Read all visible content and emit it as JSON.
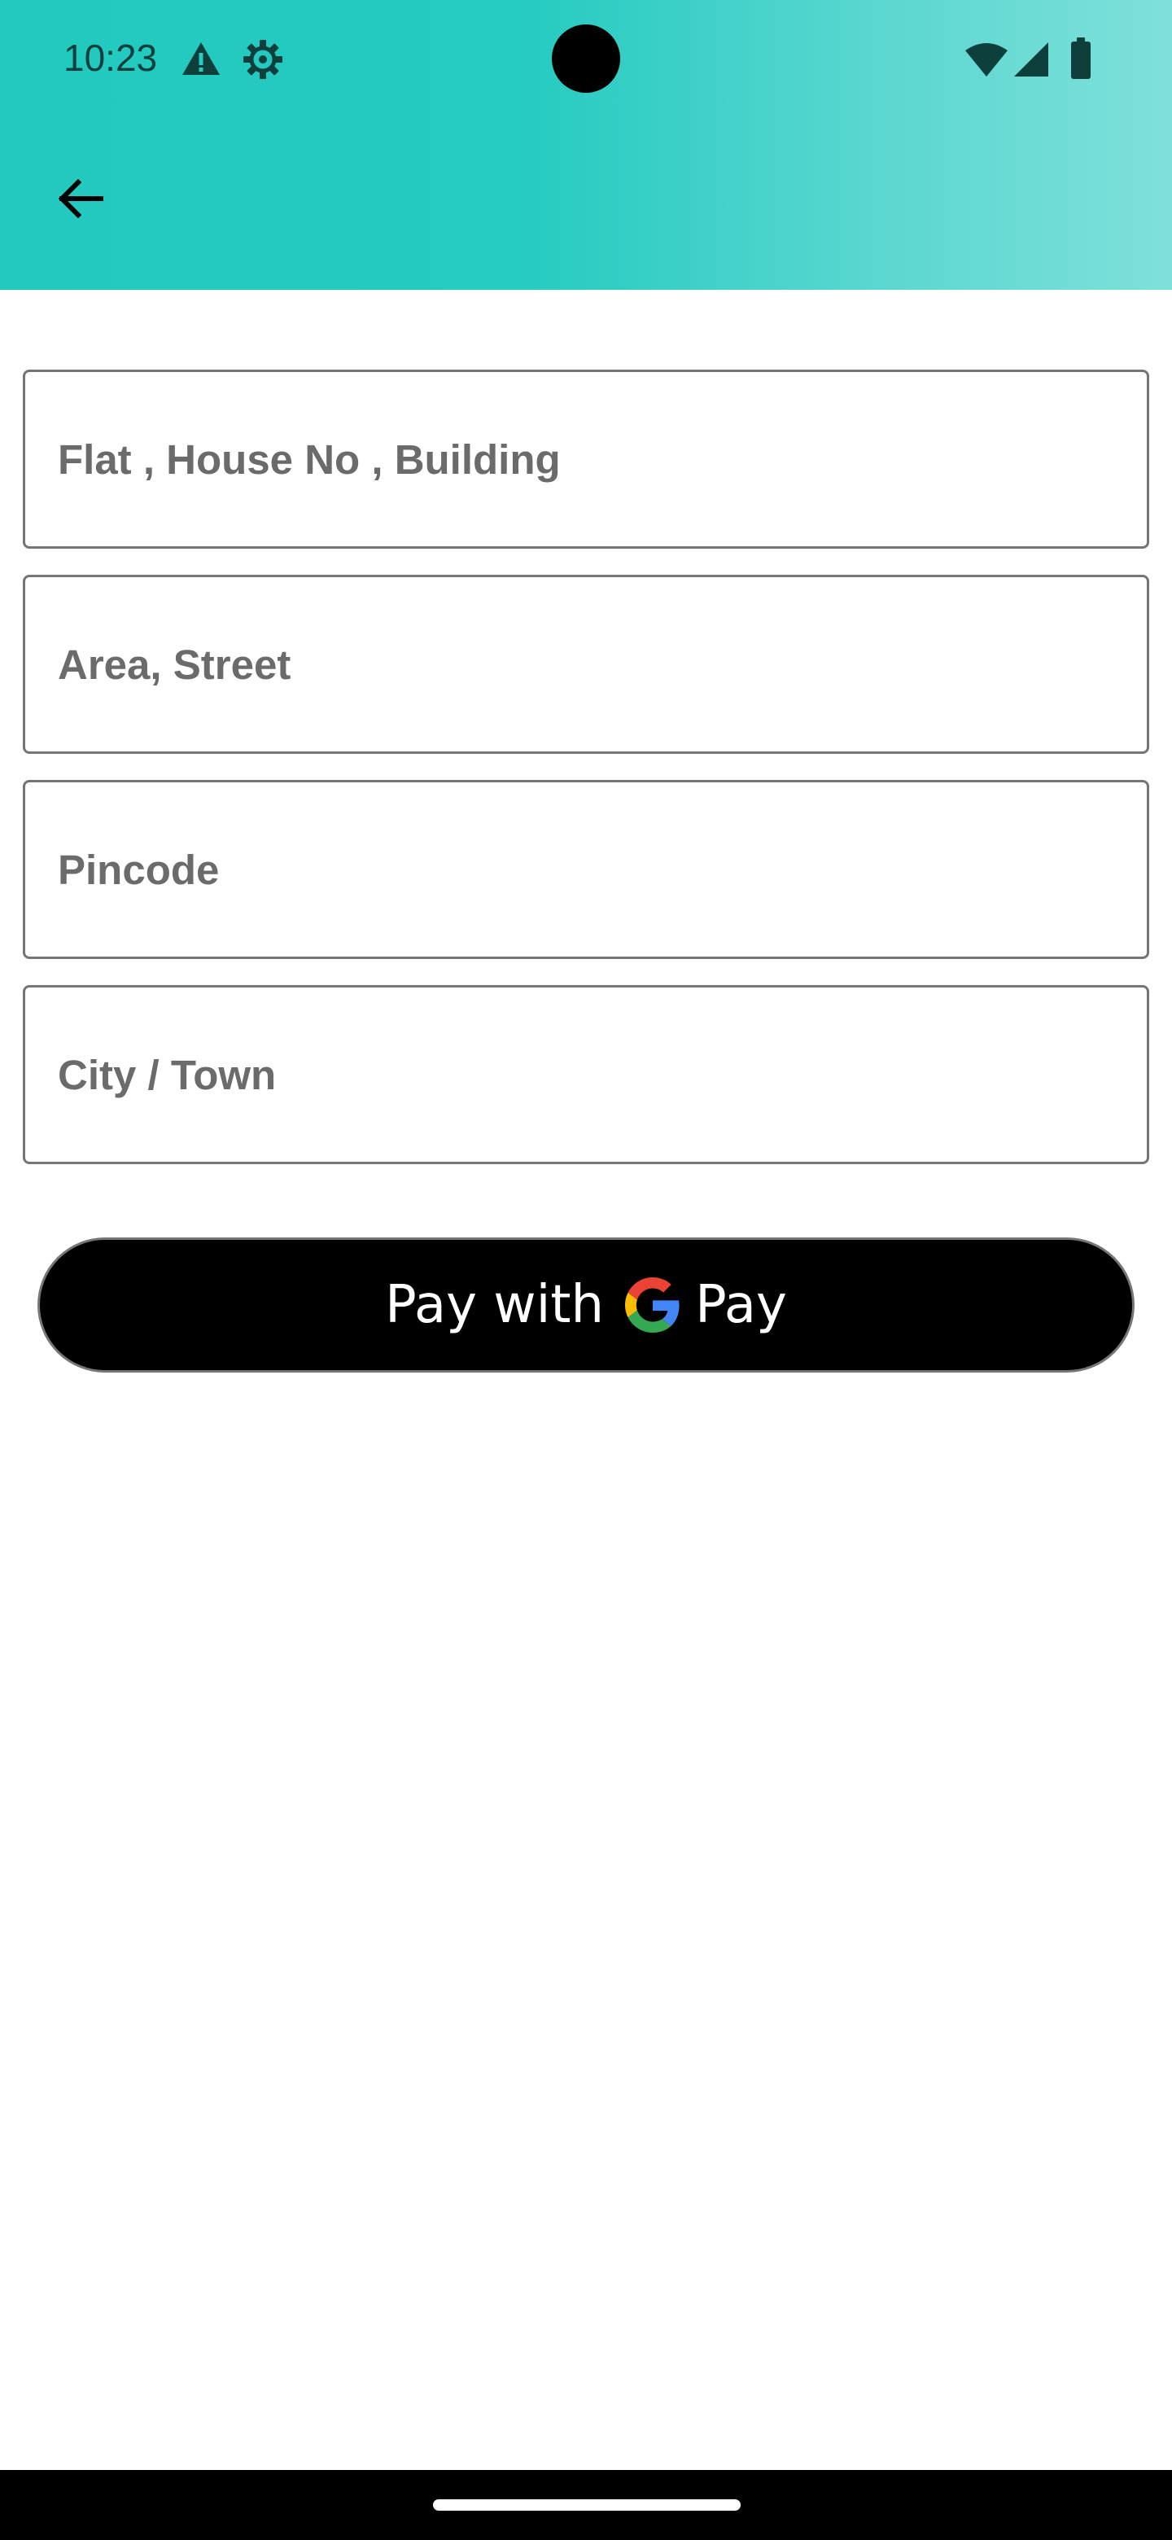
{
  "status_bar": {
    "time": "10:23",
    "icons": [
      "alert-icon",
      "settings-gear-icon",
      "wifi-icon",
      "cellular-signal-icon",
      "battery-icon"
    ]
  },
  "header": {
    "back_icon": "arrow-back-icon",
    "gradient_colors": [
      "#22c9bf",
      "#7fe0da"
    ]
  },
  "form": {
    "fields": [
      {
        "placeholder": "Flat , House No , Building",
        "value": ""
      },
      {
        "placeholder": "Area, Street",
        "value": ""
      },
      {
        "placeholder": "Pincode",
        "value": ""
      },
      {
        "placeholder": "City / Town",
        "value": ""
      }
    ]
  },
  "gpay_button": {
    "prefix": "Pay with",
    "suffix": "Pay",
    "logo_icon": "google-g-icon",
    "colors": {
      "background": "#000000",
      "text": "#ffffff"
    }
  }
}
